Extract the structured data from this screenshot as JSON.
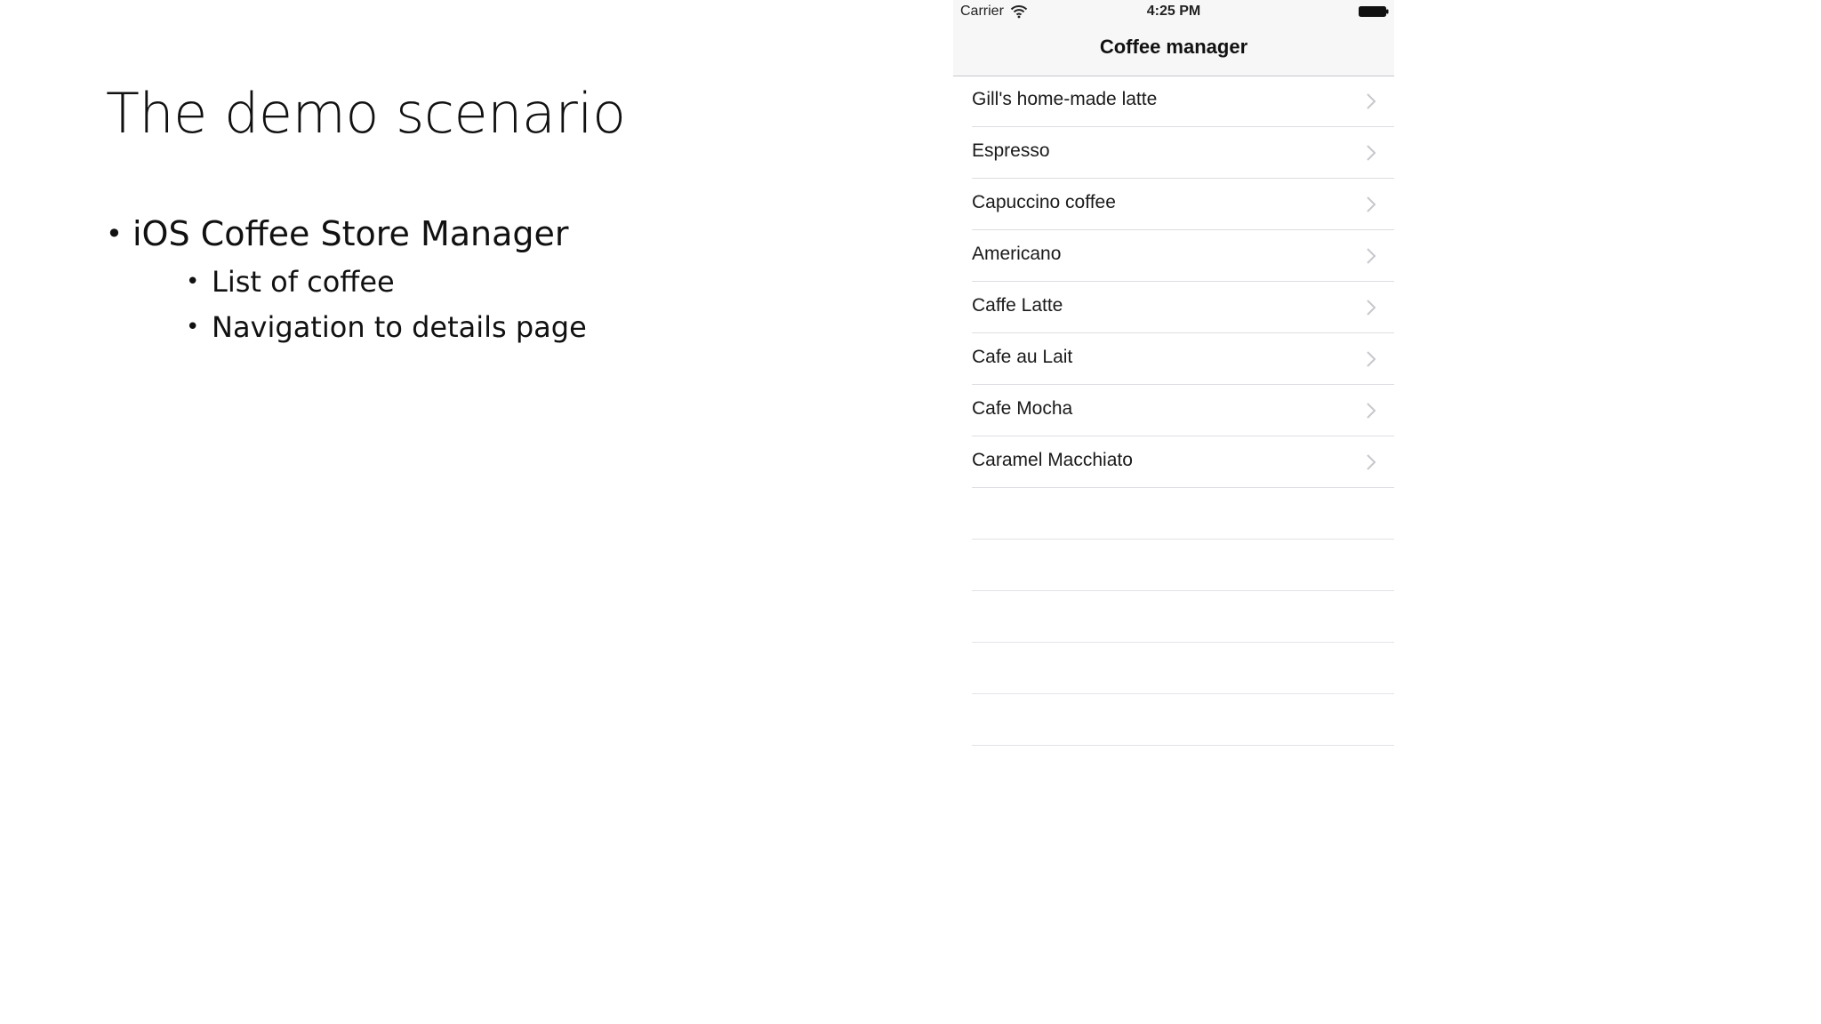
{
  "slide": {
    "title": "The demo scenario",
    "bullets": [
      {
        "text": "iOS Coffee Store Manager",
        "sub": [
          "List of coffee",
          "Navigation to details page"
        ]
      }
    ],
    "bullet_glyph": "•"
  },
  "phone": {
    "status_bar": {
      "carrier": "Carrier",
      "time": "4:25 PM",
      "icons": [
        "wifi-icon",
        "battery-icon"
      ]
    },
    "nav_title": "Coffee manager",
    "items": [
      {
        "label": "Gill's home-made latte"
      },
      {
        "label": "Espresso"
      },
      {
        "label": "Capuccino coffee"
      },
      {
        "label": "Americano"
      },
      {
        "label": "Caffe Latte"
      },
      {
        "label": "Cafe au Lait"
      },
      {
        "label": "Cafe Mocha"
      },
      {
        "label": "Caramel Macchiato"
      }
    ],
    "disclosure_icon": "chevron-right-icon",
    "colors": {
      "nav_background": "#f7f7f7",
      "separator": "#dedde2",
      "chevron": "#c7c7cc"
    }
  }
}
